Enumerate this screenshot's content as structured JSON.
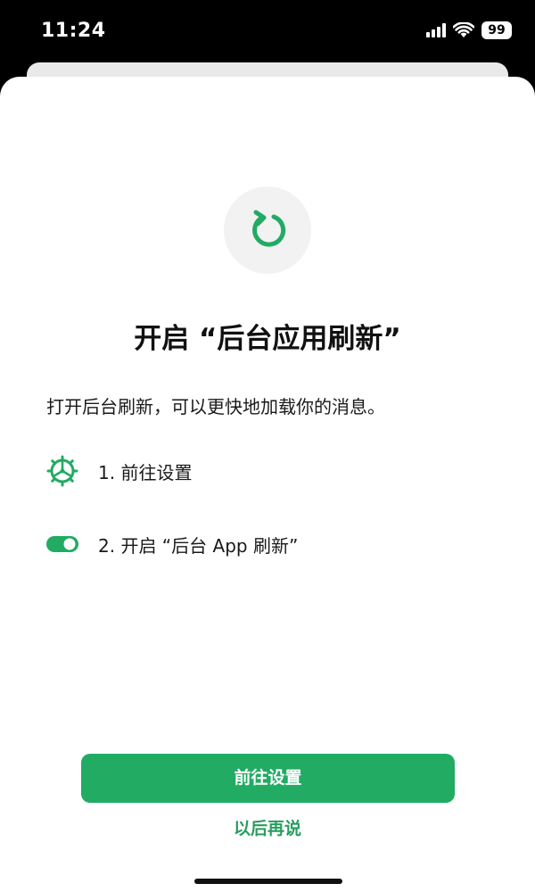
{
  "status_bar": {
    "time": "11:24",
    "battery": "99",
    "icons": [
      "signal-icon",
      "wifi-icon",
      "battery-icon"
    ]
  },
  "dialog": {
    "icon": "refresh-icon",
    "title": "开启 “后台应用刷新”",
    "description": "打开后台刷新，可以更快地加载你的消息。",
    "steps": [
      {
        "icon": "settings-gear-icon",
        "label": "1. 前往设置"
      },
      {
        "icon": "toggle-icon",
        "label": "2. 开启 “后台 App 刷新”"
      }
    ],
    "primary_button": "前往设置",
    "secondary_button": "以后再说"
  },
  "colors": {
    "accent": "#21ab63",
    "accent_text": "#2a9c5f",
    "hero_circle": "#f2f2f2",
    "status_bar_bg": "#000000"
  }
}
